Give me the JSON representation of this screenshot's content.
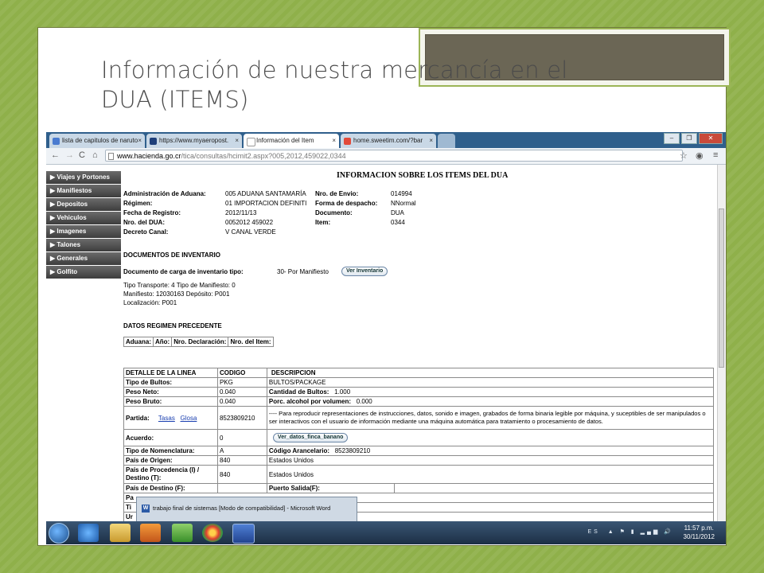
{
  "slide": {
    "title_line1": "Información de nuestra mercancía en el",
    "title_line2": "DUA (ITEMS)"
  },
  "browser": {
    "tabs": [
      {
        "label": "lista de capitulos de naruto",
        "favicon_color": "#4a7bd0"
      },
      {
        "label": "https://www.myaeropost.",
        "favicon_color": "#1f3f7a"
      },
      {
        "label": "Información del Item",
        "favicon_color": "#ffffff"
      },
      {
        "label": "home.sweetim.com/?bar",
        "favicon_color": "#e24a3a"
      }
    ],
    "url_host": "www.hacienda.go.cr",
    "url_path": "/tica/consultas/hcimit2.aspx?005,2012,459022,0344"
  },
  "sidebar": {
    "items": [
      "▶ Viajes y Portones",
      "▶ Manifiestos",
      "▶ Depositos",
      "▶ Vehiculos",
      "▶ Imagenes",
      "▶ Talones",
      "▶ Generales",
      "▶ Golfito"
    ]
  },
  "page": {
    "title": "INFORMACION SOBRE LOS ITEMS DEL DUA",
    "header_fields": {
      "aduana_label": "Administración de Aduana:",
      "aduana_value": "005  ADUANA SANTAMARÍA",
      "regimen_label": "Régimen:",
      "regimen_value": "01  IMPORTACION DEFINITI",
      "fecha_label": "Fecha de Registro:",
      "fecha_value": "2012/11/13",
      "dua_label": "Nro. del DUA:",
      "dua_value": "0052012  459022",
      "canal_label": "Decreto Canal:",
      "canal_value": "V  CANAL VERDE",
      "envio_label": "Nro. de Envio:",
      "envio_value": "014994",
      "despacho_label": "Forma de despacho:",
      "despacho_value": "NNormal",
      "documento_label": "Documento:",
      "documento_value": "DUA",
      "item_label": "Item:",
      "item_value": "0344"
    },
    "inventario": {
      "section_title": "DOCUMENTOS DE INVENTARIO",
      "tipo_label": "Documento de carga de inventario tipo:",
      "tipo_value": "30- Por Manifiesto",
      "button": "Ver Inventario",
      "line1": "Tipo Transporte: 4 Tipo de Manifiesto: 0",
      "line2": "Manifiesto: 12030163 Depósito: P001",
      "line3": "Localización: P001"
    },
    "regimen_precedente": {
      "section_title": "DATOS REGIMEN PRECEDENTE",
      "headers": [
        "Aduana:",
        "Año:",
        "Nro. Declaración:",
        "Nro. del Item:"
      ]
    },
    "detalle": {
      "headers": [
        "DETALLE DE LA LINEA",
        "CODIGO",
        "DESCRIPCION"
      ],
      "tipo_bultos_label": "Tipo de Bultos:",
      "tipo_bultos_code": "PKG",
      "tipo_bultos_desc": "BULTOS/PACKAGE",
      "peso_neto_label": "Peso Neto:",
      "peso_neto_value": "0.040",
      "cantidad_bultos_label": "Cantidad de Bultos:",
      "cantidad_bultos_value": "1.000",
      "peso_bruto_label": "Peso Bruto:",
      "peso_bruto_value": "0.040",
      "alcohol_label": "Porc. alcohol por volumen:",
      "alcohol_value": "0.000",
      "partida_label": "Partida:",
      "tasas_link": "Tasas",
      "glosa_link": "Glosa",
      "partida_code": "8523809210",
      "partida_desc": "---- Para reproducir representaciones de instrucciones, datos, sonido e imagen, grabados de forma binaria legible por máquina, y suceptibles de ser manipulados o ser interactivos con el usuario de información mediante una máquina automática para tratamiento o procesamiento de datos.",
      "acuerdo_label": "Acuerdo:",
      "acuerdo_code": "0",
      "acuerdo_button": "Ver_datos_finca_banano",
      "nomenclatura_label": "Tipo de Nomenclatura:",
      "nomenclatura_code": "A",
      "arancelario_label": "Código Arancelario:",
      "arancelario_value": "8523809210",
      "origen_label": "País de Origen:",
      "origen_code": "840",
      "origen_desc": "Estados Unidos",
      "procedencia_label": "País de Procedencia (I) / Destino (T):",
      "procedencia_code": "840",
      "procedencia_desc": "Estados Unidos",
      "destino_label": "País de Destino (F):",
      "puerto_label": "Puerto Salida(F):",
      "cut_row1": "Pa",
      "cut_row2": "Ti",
      "cut_row3": "Ur"
    }
  },
  "taskbar": {
    "popup_text": "trabajo final de sistemas [Modo de compatibilidad] - Microsoft Word",
    "lang": "ES",
    "time": "11:57 p.m.",
    "date": "30/11/2012"
  }
}
